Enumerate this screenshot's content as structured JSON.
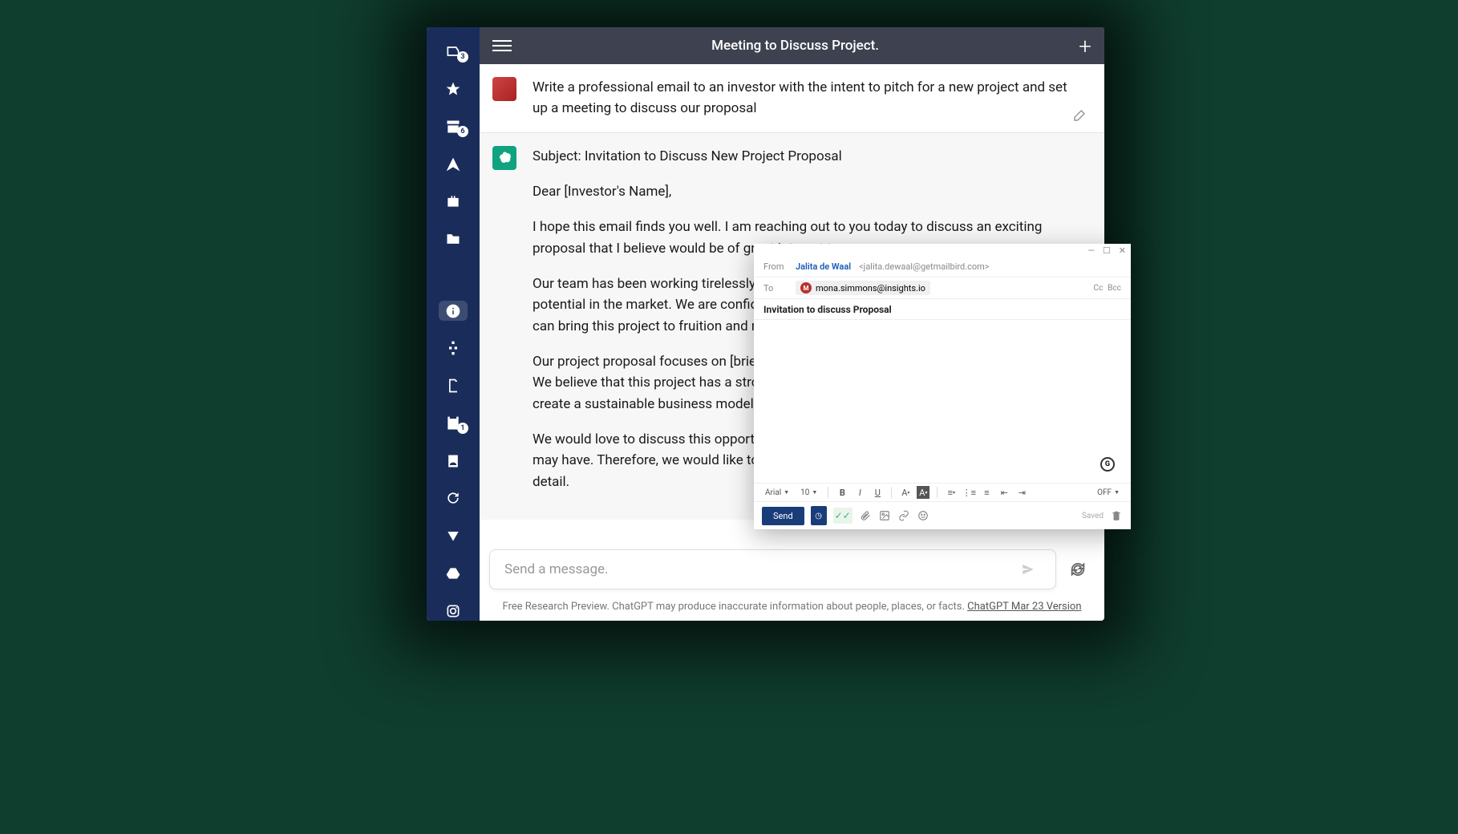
{
  "header": {
    "title": "Meeting to Discuss Project."
  },
  "sidebar": {
    "inbox_badge": "3",
    "archive_badge": "6",
    "calendar_badge": "1"
  },
  "user_msg": "Write a professional email to an investor with the intent to pitch for a new project and set up a meeting to discuss our proposal",
  "bot_msg": {
    "subject": "Subject: Invitation to Discuss New Project Proposal",
    "greeting": "Dear [Investor's Name],",
    "p1": "I hope this email finds you well. I am reaching out to you today to discuss an exciting proposal that I believe would be of great interest to you.",
    "p2": "Our team has been working tirelessly on a new idea that we believe has tremendous potential in the market. We are confident that with the right support and investment we can bring this project to fruition and make a significant impact.",
    "p3": "Our project proposal focuses on [brief description of the project and its unique features]. We believe that this project has a strong potential to generate significant returns and create a sustainable business model.",
    "p4": "We would love to discuss this opportunity with you further and answer any questions you may have. Therefore, we would like to invite you to a meeting to discuss our project in detail."
  },
  "input": {
    "placeholder": "Send a message."
  },
  "footer": {
    "text": "Free Research Preview. ChatGPT may produce inaccurate information about people, places, or facts. ",
    "link": "ChatGPT Mar 23 Version"
  },
  "compose": {
    "from_label": "From",
    "from_name": "Jalita de Waal",
    "from_email": "<jalita.dewaal@getmailbird.com>",
    "to_label": "To",
    "to_initial": "M",
    "to_email": "mona.simmons@insights.io",
    "cc": "Cc",
    "bcc": "Bcc",
    "subject": "Invitation to discuss Proposal",
    "font": "Arial",
    "size": "10",
    "off": "OFF",
    "send": "Send",
    "saved": "Saved"
  }
}
